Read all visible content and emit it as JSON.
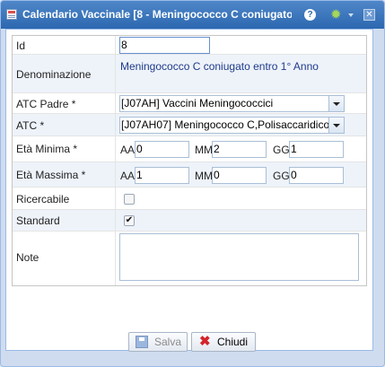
{
  "window": {
    "title": "Calendario Vaccinale [8 - Meningococco C coniugato..."
  },
  "form": {
    "id": {
      "label": "Id",
      "value": "8"
    },
    "denominazione": {
      "label": "Denominazione",
      "value": "Meningococco C coniugato entro 1° Anno"
    },
    "atc_padre": {
      "label": "ATC Padre *",
      "value": "[J07AH] Vaccini Meningococcici"
    },
    "atc": {
      "label": "ATC *",
      "value": "[J07AH07] Meningococco C,Polisaccaridico"
    },
    "eta_minima": {
      "label": "Età Minima *",
      "aa_label": "AA",
      "aa": "0",
      "mm_label": "MM",
      "mm": "2",
      "gg_label": "GG",
      "gg": "1"
    },
    "eta_massima": {
      "label": "Età Massima *",
      "aa_label": "AA",
      "aa": "1",
      "mm_label": "MM",
      "mm": "0",
      "gg_label": "GG",
      "gg": "0"
    },
    "ricercabile": {
      "label": "Ricercabile",
      "checked": false
    },
    "standard": {
      "label": "Standard",
      "checked": true,
      "check_glyph": "✔"
    },
    "note": {
      "label": "Note",
      "value": ""
    }
  },
  "buttons": {
    "save_label": "Salva",
    "close_label": "Chiudi"
  },
  "icons": {
    "title": "calendar-icon",
    "help": "help-icon",
    "bug": "bug-icon",
    "close": "close-icon"
  },
  "colors": {
    "title_bar": "#2c68b0",
    "value_text": "#1f3a8a",
    "close_x": "#d2262b"
  }
}
